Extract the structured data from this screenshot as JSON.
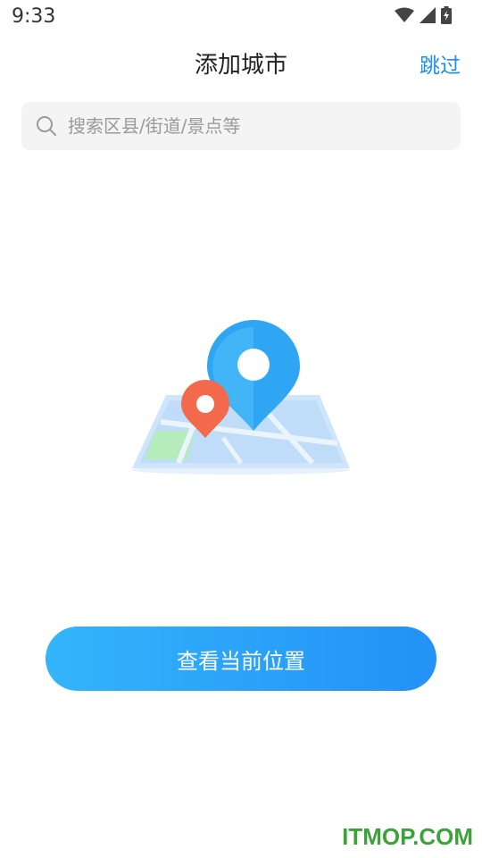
{
  "status_bar": {
    "time": "9:33",
    "icons": [
      "wifi-icon",
      "cell-signal-icon",
      "battery-icon"
    ]
  },
  "header": {
    "title": "添加城市",
    "skip_label": "跳过"
  },
  "search": {
    "placeholder": "搜索区县/街道/景点等",
    "value": ""
  },
  "illustration": {
    "icons": [
      "map-icon",
      "blue-location-pin-icon",
      "orange-location-pin-icon"
    ]
  },
  "actions": {
    "locate_label": "查看当前位置"
  },
  "watermark": {
    "text": "ITMOP.COM"
  },
  "colors": {
    "accent": "#1a8ff0",
    "button_start": "#33b5fb",
    "button_end": "#2391f6",
    "watermark": "#3ea23a"
  }
}
